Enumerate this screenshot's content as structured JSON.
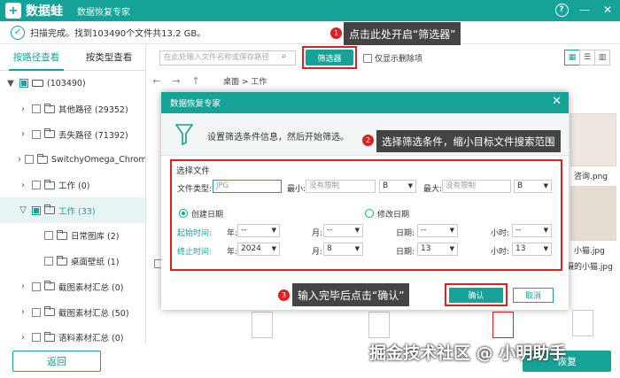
{
  "app": {
    "logo_char": "+",
    "name": "数据蛙",
    "subtitle": "数据恢复专家",
    "help": "?",
    "minimize": "—",
    "close": "✕"
  },
  "status": {
    "check": "✓",
    "text": "扫描完成。找到103490个文件共13.2 GB。"
  },
  "left_tabs": [
    {
      "label": "按路径查看",
      "active": true
    },
    {
      "label": "按类型查看",
      "active": false
    }
  ],
  "tree": [
    {
      "caret": "▼",
      "indent": 0,
      "label": "(103490)",
      "drive": true,
      "partial": true
    },
    {
      "caret": "›",
      "indent": 1,
      "label": "其他路径 (29352)"
    },
    {
      "caret": "›",
      "indent": 1,
      "label": "丢失路径 (71392)"
    },
    {
      "caret": "›",
      "indent": 1,
      "label": "SwitchyOmega_Chromium"
    },
    {
      "caret": "›",
      "indent": 1,
      "label": "工作 (0)"
    },
    {
      "caret": "▽",
      "indent": 1,
      "label": "工作 (33)",
      "selected": true,
      "partial": true
    },
    {
      "caret": "",
      "indent": 2,
      "label": "日常图库 (2)"
    },
    {
      "caret": "",
      "indent": 2,
      "label": "桌面壁纸 (1)"
    },
    {
      "caret": "›",
      "indent": 1,
      "label": "截图素材汇总 (0)"
    },
    {
      "caret": "›",
      "indent": 1,
      "label": "截图素材汇总 (50)"
    },
    {
      "caret": "›",
      "indent": 1,
      "label": "语料素材汇总 (0)"
    }
  ],
  "toolbar": {
    "search_placeholder": "在此处输入文件名称或保存路径",
    "search_icon": "⌕",
    "filter_label": "筛选器",
    "show_deleted": "仅显示删除项",
    "view_grid": "▦",
    "view_list": "☰",
    "view_detail": "▥"
  },
  "nav": {
    "back": "←",
    "forward": "→",
    "up": "↑",
    "breadcrumb": "桌面 > 工作"
  },
  "bg_files": {
    "label1": "咨询.png",
    "label2": "小猫.jpg",
    "label3": "摄的小猫.jpg"
  },
  "dialog": {
    "title": "数据恢复专家",
    "close": "✕",
    "instruction": "设置筛选条件信息，然后开始筛选。",
    "section": "选择文件",
    "file_type_label": "文件类型:",
    "file_type_placeholder": "JPG",
    "min_label": "最小:",
    "min_placeholder": "没有限制",
    "min_unit": "B",
    "max_label": "最大:",
    "max_placeholder": "没有限制",
    "max_unit": "B",
    "radio_created": "创建日期",
    "radio_modified": "修改日期",
    "start_label": "起始时间:",
    "end_label": "终止时间:",
    "year_label": "年:",
    "month_label": "月:",
    "day_label": "日期:",
    "hour_label": "小时:",
    "start": {
      "year": "--",
      "month": "--",
      "day": "--",
      "hour": "--"
    },
    "end": {
      "year": "2024",
      "month": "8",
      "day": "13",
      "hour": "13"
    },
    "ok": "确认",
    "cancel": "取消"
  },
  "callouts": {
    "c1_num": "1",
    "c1_text": "点击此处开启“筛选器”",
    "c2_num": "2",
    "c2_text": "选择筛选条件，缩小目标文件搜索范围",
    "c3_num": "3",
    "c3_text": "输入完毕后点击“确认”"
  },
  "bottom": {
    "back": "返回",
    "restore": "恢复",
    "watermark": "掘金技术社区 @ 小明助手"
  },
  "colors": {
    "accent": "#17a298",
    "highlight": "#e02020",
    "callout_bg": "#444444"
  }
}
